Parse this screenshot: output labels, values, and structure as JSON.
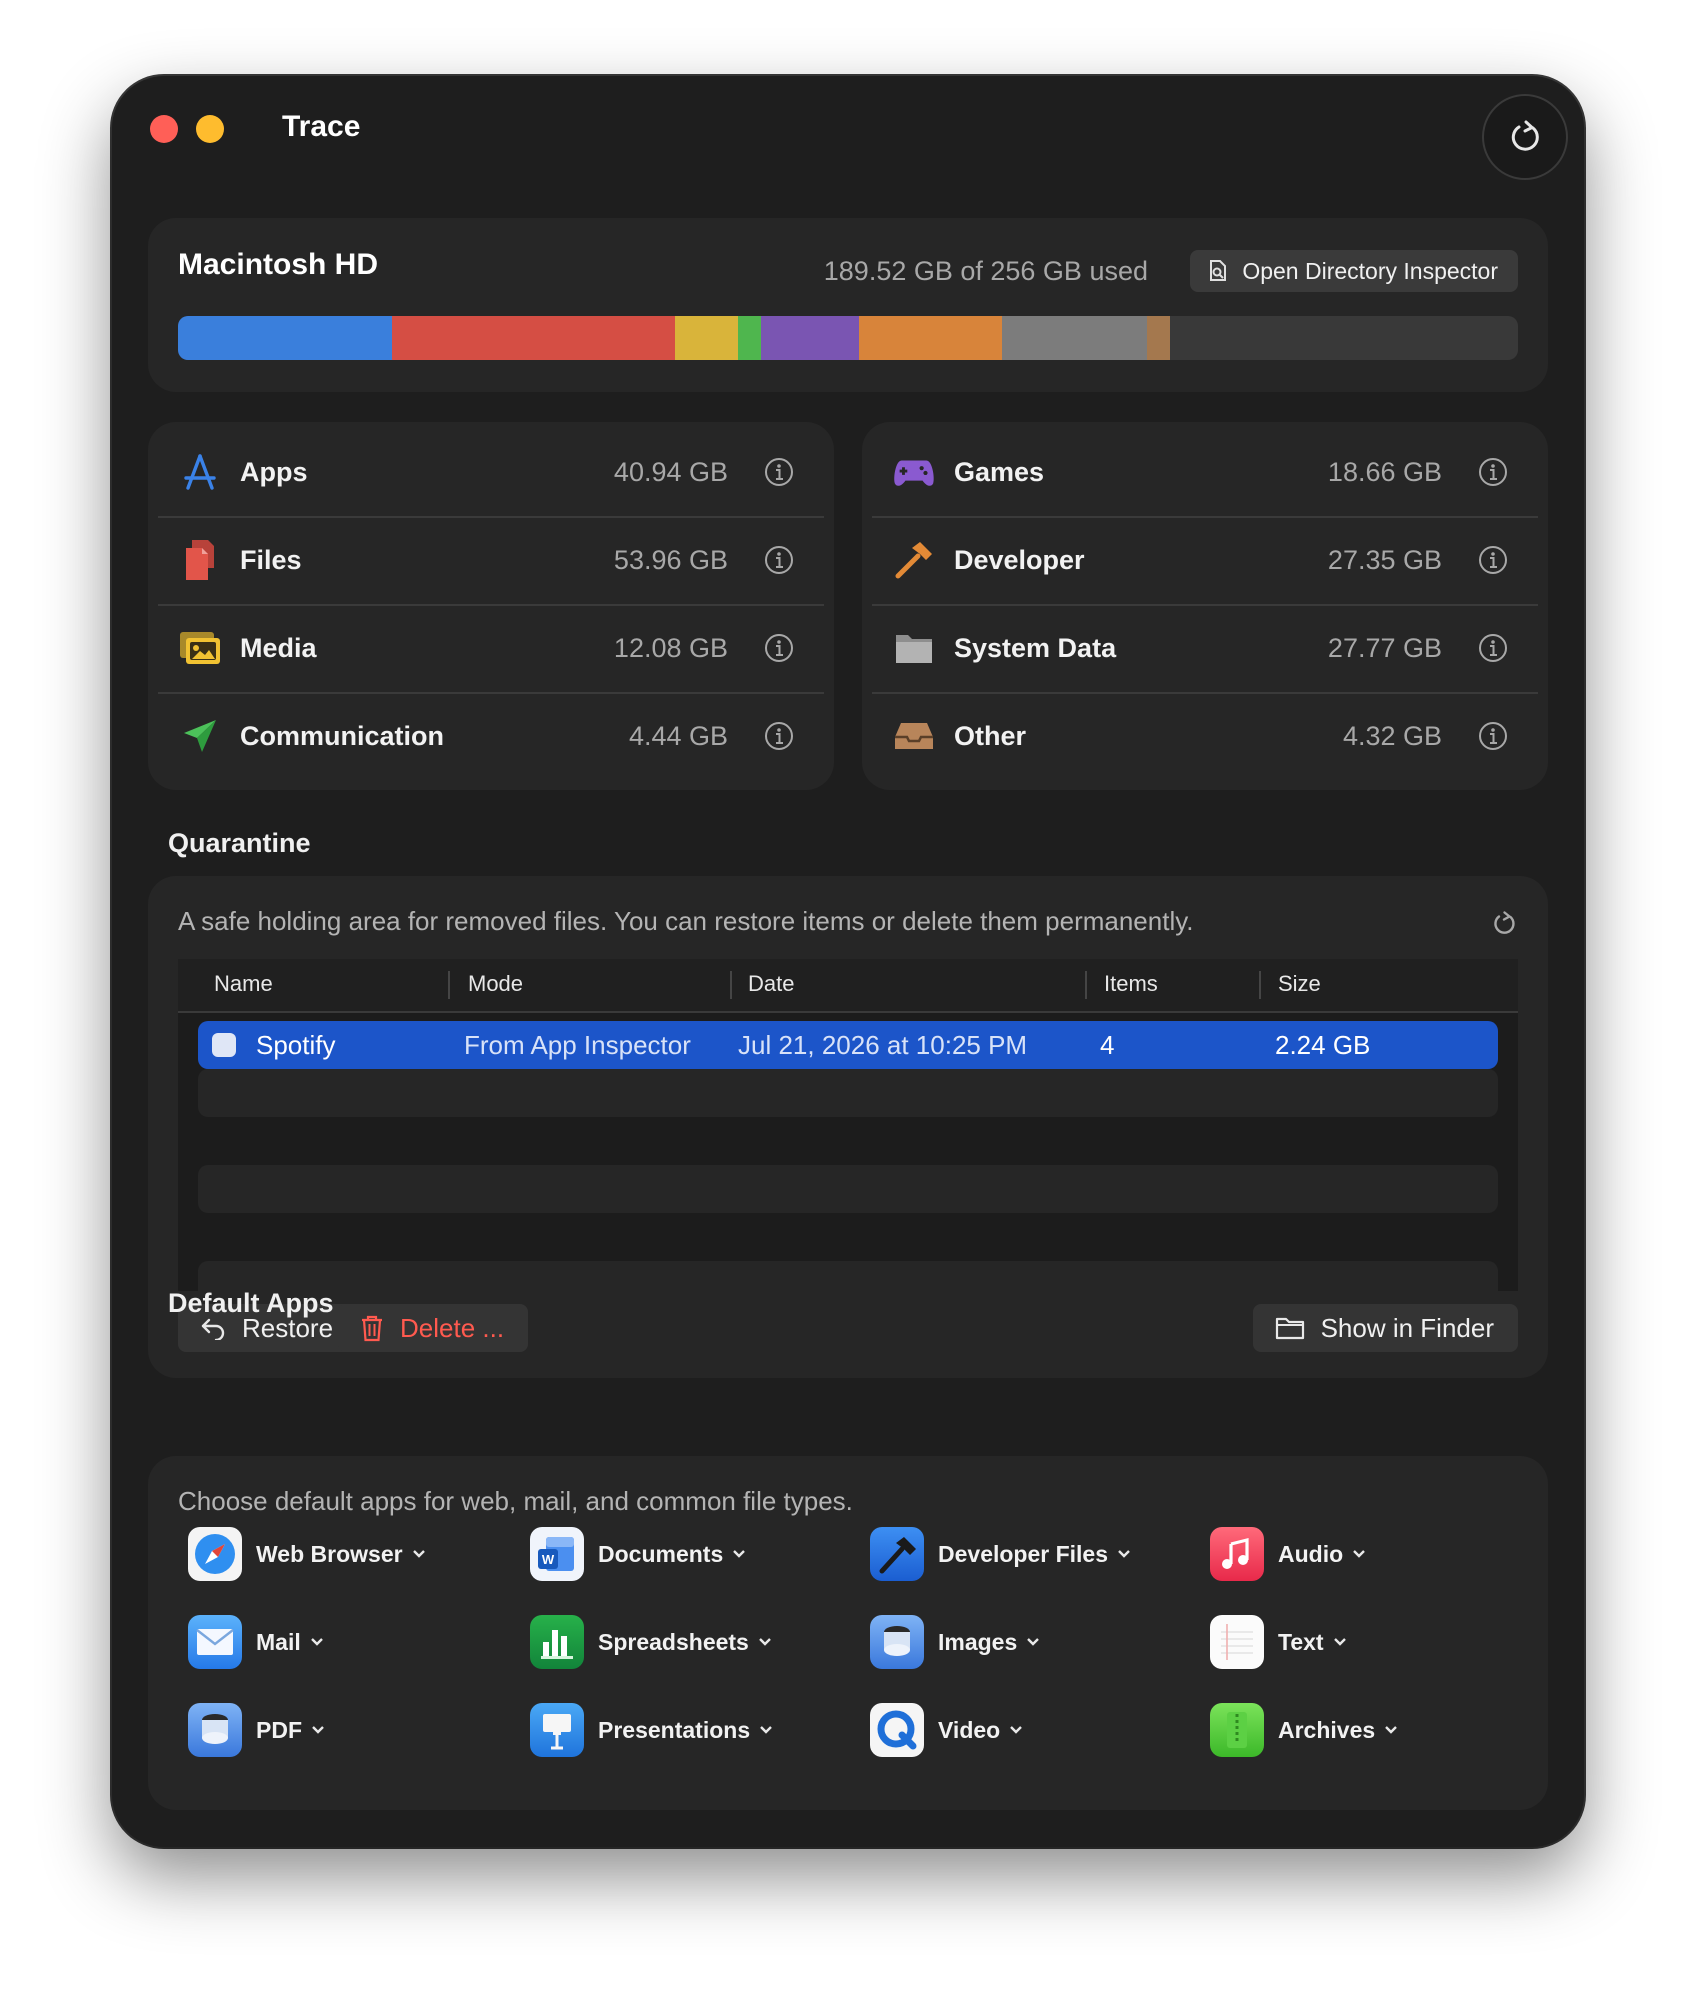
{
  "window": {
    "title": "Trace"
  },
  "disk": {
    "name": "Macintosh HD",
    "usage_text": "189.52 GB of 256 GB used",
    "inspector_button": "Open Directory Inspector",
    "segments": [
      {
        "name": "Apps",
        "gb": 40.94,
        "color": "#3a7fdc"
      },
      {
        "name": "Files",
        "gb": 53.96,
        "color": "#d54e44"
      },
      {
        "name": "Media",
        "gb": 12.08,
        "color": "#d9b43a"
      },
      {
        "name": "Communication",
        "gb": 4.44,
        "color": "#4fb64e"
      },
      {
        "name": "Games",
        "gb": 18.66,
        "color": "#7a55b2"
      },
      {
        "name": "Developer",
        "gb": 27.35,
        "color": "#d8843a"
      },
      {
        "name": "System Data",
        "gb": 27.77,
        "color": "#7c7c7c"
      },
      {
        "name": "Other",
        "gb": 4.32,
        "color": "#a4784e"
      }
    ],
    "total_gb": 256
  },
  "categories_left": [
    {
      "label": "Apps",
      "value": "40.94 GB",
      "icon": "app-store-icon"
    },
    {
      "label": "Files",
      "value": "53.96 GB",
      "icon": "documents-icon"
    },
    {
      "label": "Media",
      "value": "12.08 GB",
      "icon": "photos-icon"
    },
    {
      "label": "Communication",
      "value": "4.44 GB",
      "icon": "paper-plane-icon"
    }
  ],
  "categories_right": [
    {
      "label": "Games",
      "value": "18.66 GB",
      "icon": "gamepad-icon"
    },
    {
      "label": "Developer",
      "value": "27.35 GB",
      "icon": "hammer-icon"
    },
    {
      "label": "System Data",
      "value": "27.77 GB",
      "icon": "folder-icon"
    },
    {
      "label": "Other",
      "value": "4.32 GB",
      "icon": "tray-icon"
    }
  ],
  "quarantine": {
    "title": "Quarantine",
    "description": "A safe holding area for removed files. You can restore items or delete them permanently.",
    "columns": [
      "Name",
      "Mode",
      "Date",
      "Items",
      "Size"
    ],
    "rows": [
      {
        "name": "Spotify",
        "mode": "From App Inspector",
        "date": "Jul 21, 2026 at 10:25 PM",
        "items": "4",
        "size": "2.24 GB"
      }
    ],
    "restore_label": "Restore",
    "delete_label": "Delete ...",
    "finder_label": "Show in Finder"
  },
  "default_apps": {
    "title": "Default Apps",
    "description": "Choose default apps for web, mail, and common file types.",
    "items": [
      {
        "label": "Web Browser",
        "icon": "safari-icon"
      },
      {
        "label": "Documents",
        "icon": "word-icon"
      },
      {
        "label": "Developer Files",
        "icon": "xcode-icon"
      },
      {
        "label": "Audio",
        "icon": "music-icon"
      },
      {
        "label": "Mail",
        "icon": "mail-icon"
      },
      {
        "label": "Spreadsheets",
        "icon": "numbers-icon"
      },
      {
        "label": "Images",
        "icon": "preview-icon"
      },
      {
        "label": "Text",
        "icon": "textedit-icon"
      },
      {
        "label": "PDF",
        "icon": "preview-icon"
      },
      {
        "label": "Presentations",
        "icon": "keynote-icon"
      },
      {
        "label": "Video",
        "icon": "quicktime-icon"
      },
      {
        "label": "Archives",
        "icon": "archive-utility-icon"
      }
    ]
  }
}
